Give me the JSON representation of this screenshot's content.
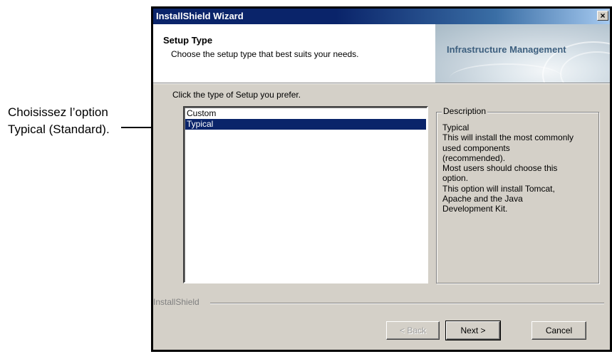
{
  "callout": {
    "line1": "Choisissez l’option",
    "line2": "Typical (Standard)."
  },
  "window": {
    "title": "InstallShield Wizard",
    "close_glyph": "×"
  },
  "header": {
    "title": "Setup Type",
    "subtitle": "Choose the setup type that best suits your needs.",
    "banner_text": "Infrastructure Management"
  },
  "main": {
    "prompt": "Click the type of Setup you prefer.",
    "setup_types": [
      "Custom",
      "Typical"
    ],
    "selected": "Typical"
  },
  "description": {
    "label": "Description",
    "lines": [
      "Typical",
      "This will install the most commonly",
      "used components",
      "(recommended).",
      "Most users should choose this",
      "option.",
      "This option will install Tomcat,",
      "Apache and the Java",
      "Development Kit."
    ]
  },
  "footer": {
    "brand": "InstallShield",
    "back_label": "< Back",
    "next_label": "Next >",
    "cancel_label": "Cancel"
  },
  "colors": {
    "title_bar": "#0a246a",
    "selection": "#0a246a",
    "dialog_bg": "#d4d0c8"
  }
}
